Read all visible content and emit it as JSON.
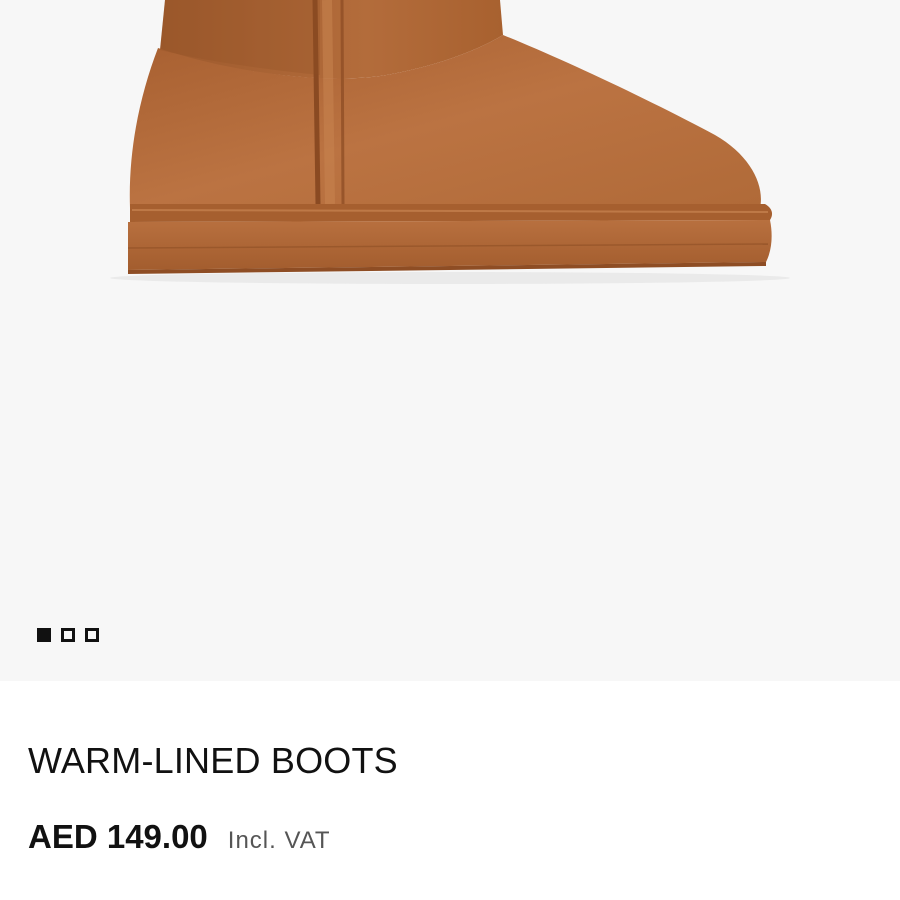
{
  "product": {
    "title": "WARM-LINED BOOTS",
    "price": "AED 149.00",
    "vat_note": "Incl. VAT",
    "image_subject": "tan suede boot",
    "boot_color": "#b56a3a"
  },
  "gallery": {
    "image_count": 3,
    "active_index": 0
  }
}
